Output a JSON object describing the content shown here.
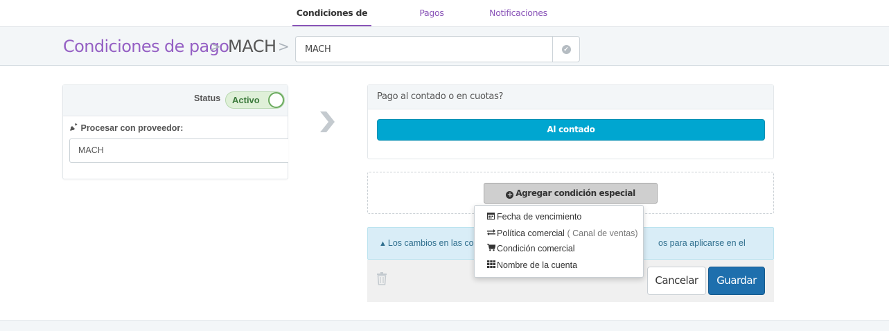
{
  "tabs": [
    {
      "label": "Condiciones de pago",
      "active": true
    },
    {
      "label": "Pagos personalizados",
      "active": false
    },
    {
      "label": "Notificaciones",
      "active": false
    }
  ],
  "header": {
    "breadcrumb_root": "Condiciones de pago",
    "separator": ">",
    "breadcrumb_current": "MACH",
    "name_input_value": "MACH",
    "confirm_icon": "check-circle-icon"
  },
  "left_card": {
    "status_label": "Status",
    "status_toggle_label": "Activo",
    "status_on": true,
    "provider_label": "Procesar con proveedor:",
    "provider_value": "MACH"
  },
  "payment_card": {
    "question": "Pago al contado o en cuotas?",
    "option_label": "Al contado"
  },
  "special_condition": {
    "add_button_label": "Agregar condición especial",
    "menu": [
      {
        "icon": "calendar-icon",
        "label": "Fecha de vencimiento",
        "note": ""
      },
      {
        "icon": "exchange-icon",
        "label": "Política comercial",
        "note": "( Canal de ventas)"
      },
      {
        "icon": "cart-icon",
        "label": "Condición comercial",
        "note": ""
      },
      {
        "icon": "grid-icon",
        "label": "Nombre de la cuenta",
        "note": ""
      }
    ]
  },
  "alert": {
    "text_left": "Los cambios en las cond",
    "text_right": "os para aplicarse en el checkout."
  },
  "actions": {
    "cancel_label": "Cancelar",
    "save_label": "Guardar"
  },
  "colors": {
    "accent_purple": "#9560c4",
    "primary_blue": "#1e6fad",
    "option_cyan": "#00a6d0",
    "info_bg": "#d9edf7"
  }
}
